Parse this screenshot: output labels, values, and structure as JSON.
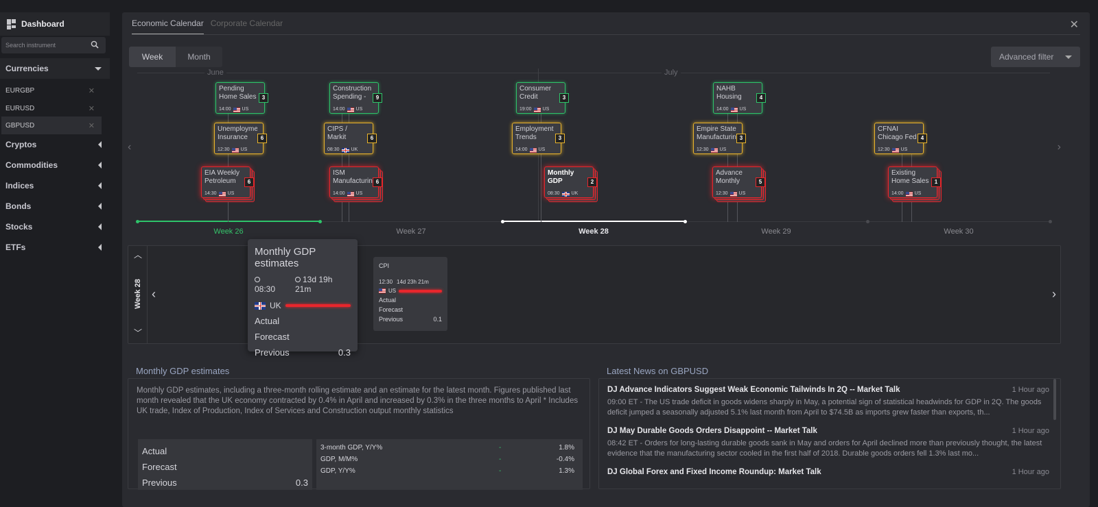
{
  "sidebar": {
    "dashboard": "Dashboard",
    "search_placeholder": "Search instrument",
    "currencies": "Currencies",
    "instruments": [
      "EURGBP",
      "EURUSD",
      "GBPUSD"
    ],
    "groups": [
      "Cryptos",
      "Commodities",
      "Indices",
      "Bonds",
      "Stocks",
      "ETFs"
    ]
  },
  "tabs": [
    "Economic Calendar",
    "Corporate Calendar"
  ],
  "view": {
    "week": "Week",
    "month": "Month"
  },
  "advanced_filter": "Advanced filter",
  "months": [
    "June",
    "July"
  ],
  "weeks": [
    "Week 26",
    "Week 27",
    "Week 28",
    "Week 29",
    "Week 30"
  ],
  "events": [
    {
      "name": "Pending Home Sales",
      "time": "14:00",
      "country": "US",
      "count": "3"
    },
    {
      "name": "Unemployment Insurance",
      "time": "12:30",
      "country": "US",
      "count": "6"
    },
    {
      "name": "EIA Weekly Petroleum",
      "time": "14:30",
      "country": "US",
      "count": "6"
    },
    {
      "name": "Construction Spending -",
      "time": "14:00",
      "country": "US",
      "count": "9"
    },
    {
      "name": "CIPS / Markit",
      "time": "08:30",
      "country": "UK",
      "count": "6"
    },
    {
      "name": "ISM Manufacturing",
      "time": "14:00",
      "country": "US",
      "count": "6"
    },
    {
      "name": "Consumer Credit",
      "time": "19:00",
      "country": "US",
      "count": "3"
    },
    {
      "name": "Employment Trends",
      "time": "14:00",
      "country": "US",
      "count": "3"
    },
    {
      "name": "Monthly GDP",
      "time": "08:30",
      "country": "UK",
      "count": "2"
    },
    {
      "name": "NAHB Housing",
      "time": "14:00",
      "country": "US",
      "count": "4"
    },
    {
      "name": "Empire State Manufacturing",
      "time": "12:30",
      "country": "US",
      "count": "3"
    },
    {
      "name": "Advance Monthly",
      "time": "12:30",
      "country": "US",
      "count": "5"
    },
    {
      "name": "CFNAI Chicago Fed",
      "time": "12:30",
      "country": "US",
      "count": "4"
    },
    {
      "name": "Existing Home Sales",
      "time": "14:00",
      "country": "US",
      "count": "1"
    }
  ],
  "week_panel": {
    "label": "Week 28",
    "popup": {
      "title": "Monthly GDP estimates",
      "time": "08:30",
      "countdown": "13d 19h 21m",
      "country": "UK",
      "actual": "Actual",
      "forecast": "Forecast",
      "previous": "Previous",
      "previous_value": "0.3"
    },
    "cpi": {
      "title": "CPI",
      "time": "12:30",
      "countdown": "14d 23h 21m",
      "country": "US",
      "actual": "Actual",
      "forecast": "Forecast",
      "previous": "Previous",
      "previous_value": "0.1"
    }
  },
  "detail": {
    "title": "Monthly GDP estimates",
    "description": "Monthly GDP estimates, including a three-month rolling estimate and an estimate for the latest month. Figures published last month revealed that the UK economy contracted by 0.4% in April and increased by 0.3% in the three months to April * Includes UK trade, Index of Production, Index of Services and Construction output monthly statistics",
    "actual": "Actual",
    "forecast": "Forecast",
    "previous": "Previous",
    "previous_value": "0.3",
    "stats": [
      {
        "name": "3-month GDP, Y/Y%",
        "dash": "-",
        "value": "1.8%"
      },
      {
        "name": "GDP, M/M%",
        "dash": "-",
        "value": "-0.4%"
      },
      {
        "name": "GDP, Y/Y%",
        "dash": "-",
        "value": "1.3%"
      }
    ]
  },
  "news": {
    "title": "Latest News on GBPUSD",
    "items": [
      {
        "headline": "DJ Advance Indicators Suggest Weak Economic Tailwinds In 2Q -- Market Talk",
        "ago": "1 Hour ago",
        "body": "09:00 ET - The US trade deficit in goods widens sharply in May, a potential sign of statistical headwinds for GDP in 2Q. The goods deficit jumped a seasonally adjusted 5.1% last month from April to $74.5B as imports grew faster than exports, th..."
      },
      {
        "headline": "DJ May Durable Goods Orders Disappoint -- Market Talk",
        "ago": "1 Hour ago",
        "body": "08:42 ET - Orders for long-lasting durable goods sank in May and orders for April declined more than previously thought, the latest evidence that the manufacturing sector cooled in the first half of 2018. Durable goods orders fell 1.3% last mo..."
      },
      {
        "headline": "DJ Global Forex and Fixed Income Roundup: Market Talk",
        "ago": "1 Hour ago",
        "body": ""
      }
    ]
  }
}
